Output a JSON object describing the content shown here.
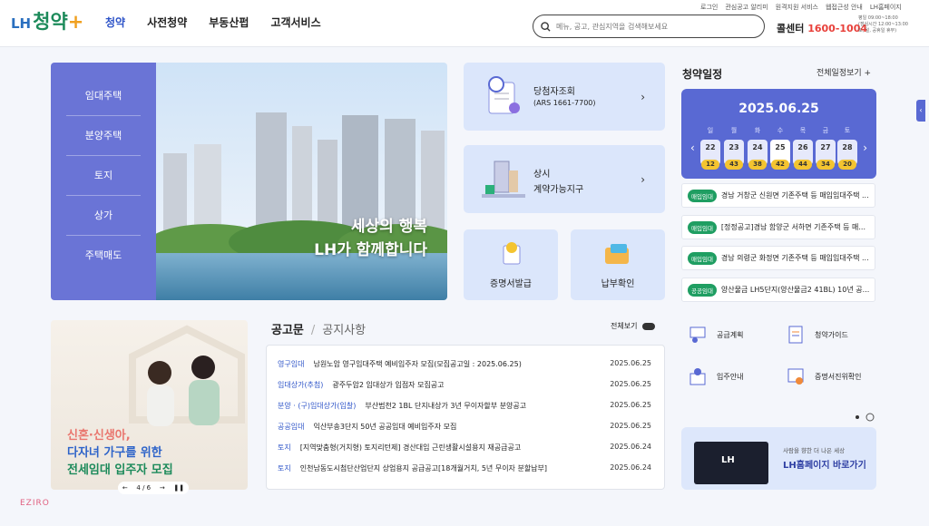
{
  "header": {
    "logo_lh": "LH",
    "logo_text": "청약",
    "logo_plus": "+",
    "nav": [
      "청약",
      "사전청약",
      "부동산펍",
      "고객서비스"
    ],
    "search_placeholder": "메뉴, 공고, 관심지역을 검색해보세요",
    "utils": [
      "로그인",
      "관심공고 알리미",
      "원격지원 서비스",
      "웹접근성 안내",
      "LH홈페이지"
    ],
    "callcenter_label": "콜센터",
    "callcenter_number": "1600-1004",
    "hours": [
      "평일 09:00~18:00",
      "(점심시간 12:00~13:00",
      "토, 일, 공휴일 휴무)"
    ]
  },
  "sidemenu": [
    "임대주택",
    "분양주택",
    "토지",
    "상가",
    "주택매도"
  ],
  "banner": {
    "line1": "세상의 행복",
    "line2": "LH가 함께합니다"
  },
  "cards": {
    "winner_title": "당첨자조회",
    "winner_sub": "(ARS 1661-7700)",
    "contract_title": "상시",
    "contract_sub": "계약가능지구",
    "cert_label": "증명서발급",
    "payment_label": "납부확인"
  },
  "schedule": {
    "title": "청약일정",
    "more": "전체일정보기 +",
    "date": "2025.06.25",
    "weekdays": [
      "일",
      "월",
      "화",
      "수",
      "목",
      "금",
      "토"
    ],
    "days": [
      {
        "day": "22",
        "count": "12"
      },
      {
        "day": "23",
        "count": "43"
      },
      {
        "day": "24",
        "count": "38"
      },
      {
        "day": "25",
        "count": "42"
      },
      {
        "day": "26",
        "count": "44"
      },
      {
        "day": "27",
        "count": "34"
      },
      {
        "day": "28",
        "count": "20"
      }
    ],
    "items": [
      {
        "badge": "매입임대",
        "text": "경남 거창군 신원면 기존주택 등 매입임대주택 ..."
      },
      {
        "badge": "매입임대",
        "text": "[정정공고]경남 함양군 서하면 기존주택 등 매..."
      },
      {
        "badge": "매입임대",
        "text": "경남 의령군 화정면 기존주택 등 매입임대주택 ..."
      },
      {
        "badge": "공공임대",
        "text": "양산물금 LH5단지(양산물금2 41BL) 10년 공..."
      }
    ]
  },
  "quick": [
    "공급계획",
    "청약가이드",
    "입주안내",
    "증명서진위확인"
  ],
  "promo": {
    "line1": "신혼·신생아,",
    "line2": "다자녀 가구를 위한",
    "line3": "전세임대 입주자 모집",
    "pager": "4 / 6"
  },
  "notice": {
    "tab_active": "공고문",
    "tab_inactive": "공지사항",
    "more": "전체보기",
    "rows": [
      {
        "cat": "영구임대",
        "title": "남원노암 영구임대주택 예비입주자 모집(모집공고일 : 2025.06.25)",
        "date": "2025.06.25"
      },
      {
        "cat": "임대상가(추첨)",
        "title": "광주두암2 임대상가 입점자 모집공고",
        "date": "2025.06.25"
      },
      {
        "cat": "분양 · (구)임대상가(입찰)",
        "title": "부산범천2 1BL 단지내상가 3년 무이자할부 분양공고",
        "date": "2025.06.25"
      },
      {
        "cat": "공공임대",
        "title": "익산부송3단지 50년 공공임대 예비입주자 모집",
        "date": "2025.06.25"
      },
      {
        "cat": "토지",
        "title": "[지역맞춤형(거치형) 토지리턴제] 경산대임 근린생활시설용지 재공급공고",
        "date": "2025.06.24"
      },
      {
        "cat": "토지",
        "title": "인천남동도시첨단산업단지 상업용지 공급공고[18개월거치, 5년 무이자 분할납부]",
        "date": "2025.06.24"
      }
    ]
  },
  "lhhome": {
    "sub": "사람을 향한 더 나은 세상",
    "main": "LH홈페이지 바로가기",
    "screen_logo": "LH"
  },
  "watermark": "EZIRO",
  "colors": {
    "primary": "#5969d3",
    "side": "#6a74d6",
    "badge": "#1f9e62",
    "count": "#f4c430",
    "call": "#e8403a"
  }
}
